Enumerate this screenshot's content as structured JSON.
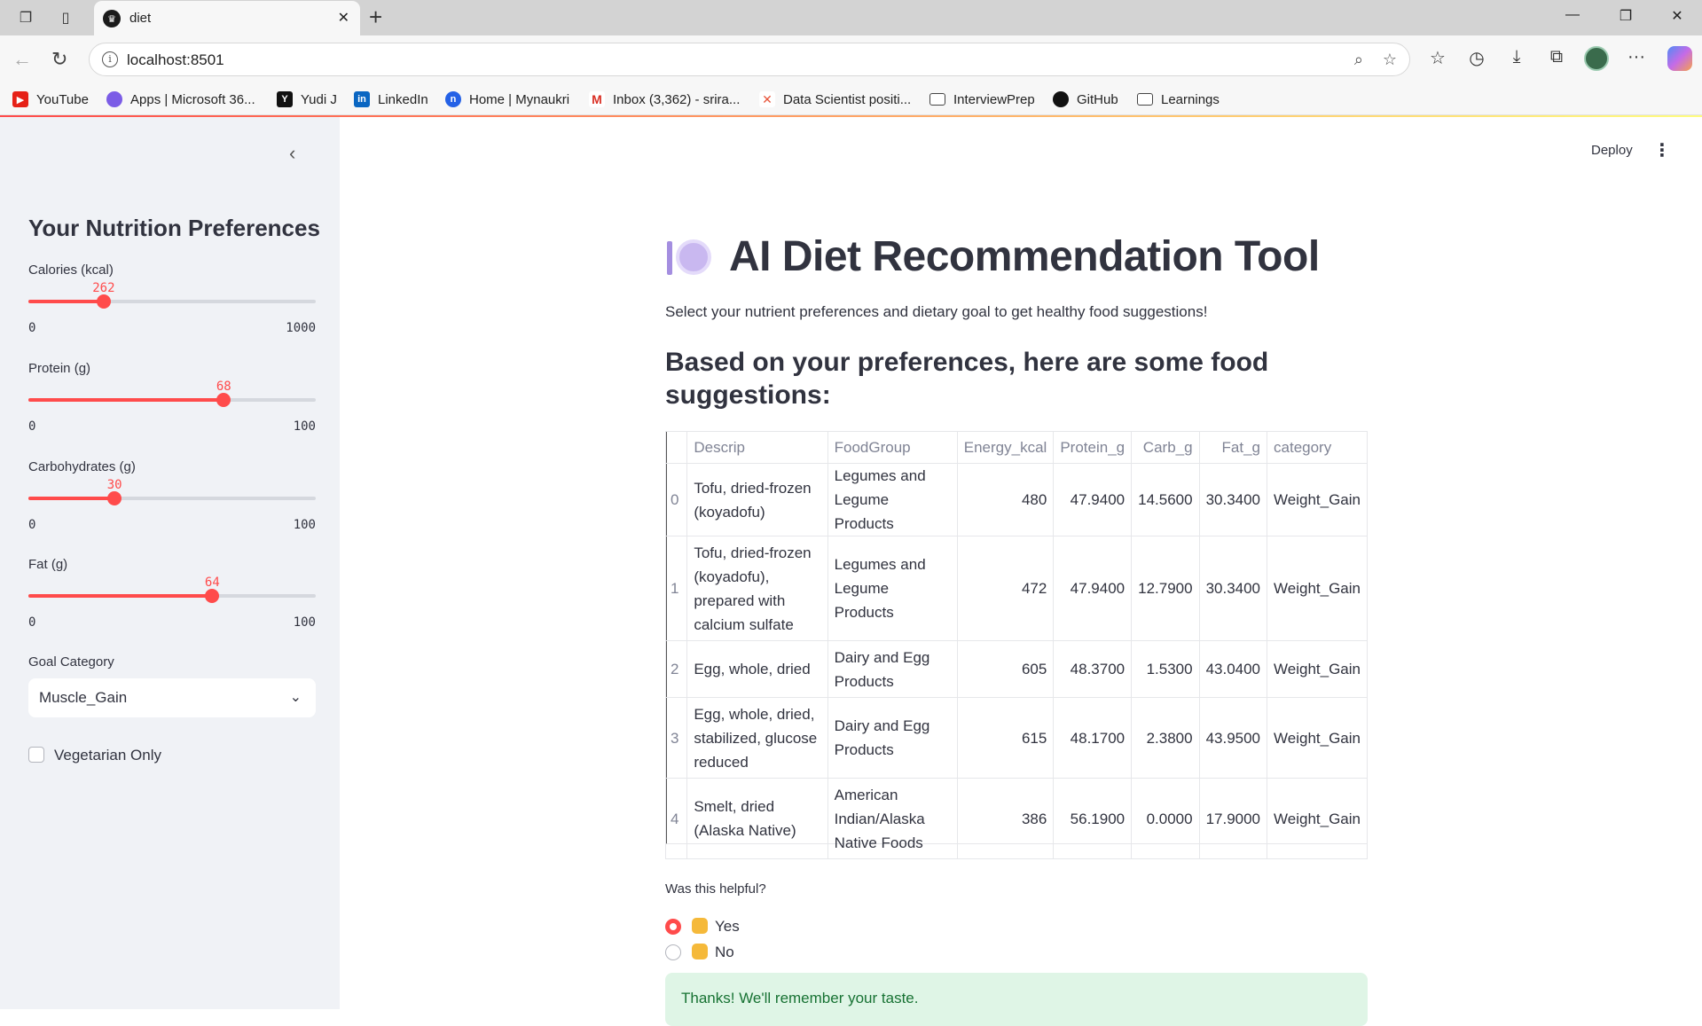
{
  "browser": {
    "tab_title": "diet",
    "url": "localhost:8501",
    "bookmarks": [
      {
        "label": "YouTube",
        "icon": "youtube-icon",
        "color": "#e62117"
      },
      {
        "label": "Apps | Microsoft 36...",
        "icon": "microsoft365-icon",
        "color": "#7b5ce6"
      },
      {
        "label": "Yudi J",
        "icon": "yudi-icon",
        "color": "#111111"
      },
      {
        "label": "LinkedIn",
        "icon": "linkedin-icon",
        "color": "#0a66c2"
      },
      {
        "label": "Home | Mynaukri",
        "icon": "naukri-icon",
        "color": "#2461e6"
      },
      {
        "label": "Inbox (3,362) - srira...",
        "icon": "gmail-icon",
        "color": "#d93025"
      },
      {
        "label": "Data Scientist positi...",
        "icon": "jobs-icon",
        "color": "#e8553b"
      },
      {
        "label": "InterviewPrep",
        "icon": "folder-icon",
        "color": "#444444"
      },
      {
        "label": "GitHub",
        "icon": "github-icon",
        "color": "#111111"
      },
      {
        "label": "Learnings",
        "icon": "folder-icon",
        "color": "#444444"
      }
    ]
  },
  "sidebar": {
    "title": "Your Nutrition Preferences",
    "sliders": [
      {
        "label": "Calories (kcal)",
        "value": 262,
        "min": 0,
        "max": 1000
      },
      {
        "label": "Protein (g)",
        "value": 68,
        "min": 0,
        "max": 100
      },
      {
        "label": "Carbohydrates (g)",
        "value": 30,
        "min": 0,
        "max": 100
      },
      {
        "label": "Fat (g)",
        "value": 64,
        "min": 0,
        "max": 100
      }
    ],
    "goal_label": "Goal Category",
    "goal_value": "Muscle_Gain",
    "vegetarian_label": "Vegetarian Only",
    "vegetarian_checked": false
  },
  "header": {
    "deploy_label": "Deploy"
  },
  "main": {
    "title": "AI Diet Recommendation Tool",
    "subtitle": "Select your nutrient preferences and dietary goal to get healthy food suggestions!",
    "suggestions_heading": "Based on your preferences, here are some food suggestions:",
    "table": {
      "columns": [
        "Descrip",
        "FoodGroup",
        "Energy_kcal",
        "Protein_g",
        "Carb_g",
        "Fat_g",
        "category"
      ],
      "rows": [
        {
          "index": "0",
          "cells": [
            "Tofu, dried-frozen (koyadofu)",
            "Legumes and Legume Products",
            "480",
            "47.9400",
            "14.5600",
            "30.3400",
            "Weight_Gain"
          ]
        },
        {
          "index": "1",
          "cells": [
            "Tofu, dried-frozen (koyadofu), prepared with calcium sulfate",
            "Legumes and Legume Products",
            "472",
            "47.9400",
            "12.7900",
            "30.3400",
            "Weight_Gain"
          ]
        },
        {
          "index": "2",
          "cells": [
            "Egg, whole, dried",
            "Dairy and Egg Products",
            "605",
            "48.3700",
            "1.5300",
            "43.0400",
            "Weight_Gain"
          ]
        },
        {
          "index": "3",
          "cells": [
            "Egg, whole, dried, stabilized, glucose reduced",
            "Dairy and Egg Products",
            "615",
            "48.1700",
            "2.3800",
            "43.9500",
            "Weight_Gain"
          ]
        },
        {
          "index": "4",
          "cells": [
            "Smelt, dried (Alaska Native)",
            "American Indian/Alaska Native Foods",
            "386",
            "56.1900",
            "0.0000",
            "17.9000",
            "Weight_Gain"
          ]
        }
      ]
    },
    "feedback": {
      "label": "Was this helpful?",
      "options": [
        {
          "label": "Yes",
          "icon": "thumbs-up-icon",
          "selected": true
        },
        {
          "label": "No",
          "icon": "thumbs-down-icon",
          "selected": false
        }
      ]
    },
    "success_message": "Thanks! We'll remember your taste."
  },
  "colors": {
    "accent": "#ff4b4b",
    "sidebar_bg": "#f0f2f6",
    "success_bg": "#dff5e6",
    "success_text": "#177233"
  }
}
